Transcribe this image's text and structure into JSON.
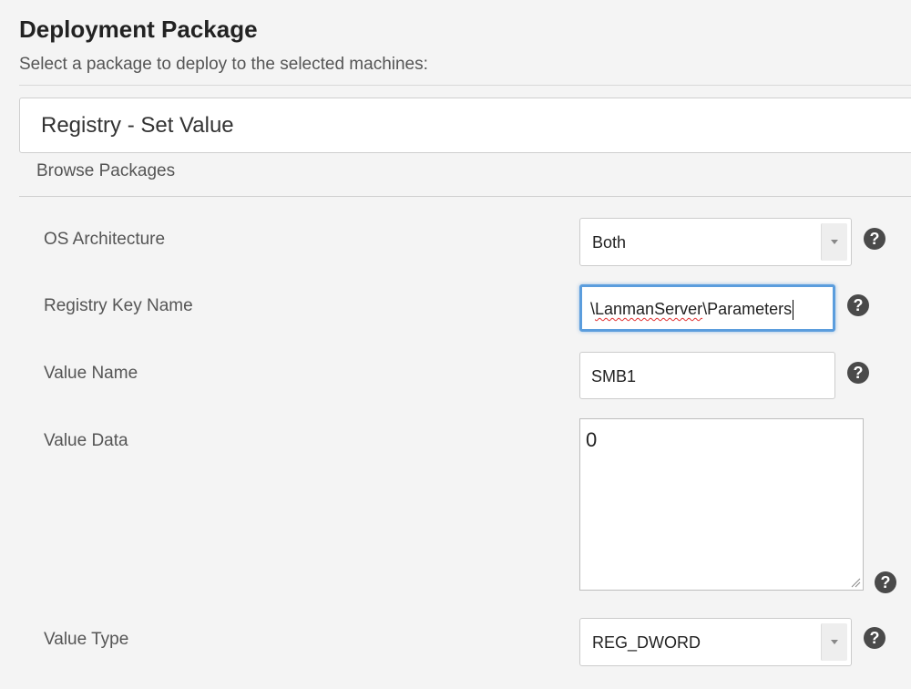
{
  "header": {
    "title": "Deployment Package",
    "subtitle": "Select a package to deploy to the selected machines:"
  },
  "package": {
    "selected_name": "Registry - Set Value",
    "browse_label": "Browse Packages"
  },
  "fields": {
    "os_architecture": {
      "label": "OS Architecture",
      "value": "Both"
    },
    "registry_key_name": {
      "label": "Registry Key Name",
      "value_prefix": "\\",
      "value_misspelled": "LanmanServer",
      "value_suffix": "\\Parameters"
    },
    "value_name": {
      "label": "Value Name",
      "value": "SMB1"
    },
    "value_data": {
      "label": "Value Data",
      "value": "0"
    },
    "value_type": {
      "label": "Value Type",
      "value": "REG_DWORD"
    }
  },
  "help_glyph": "?",
  "icons": {
    "help": "question-circle-icon",
    "dropdown": "chevron-down-icon",
    "resize": "resize-handle-icon"
  },
  "colors": {
    "focus_border": "#5b9ddd",
    "help_icon_bg": "#4a4a4a",
    "spellcheck_underline": "#e03030"
  }
}
